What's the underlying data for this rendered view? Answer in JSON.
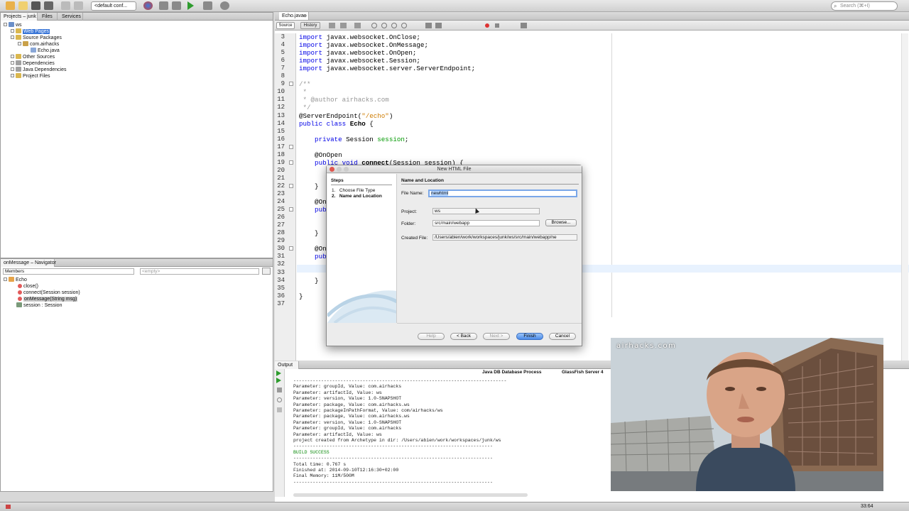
{
  "toolbar": {
    "config": "<default conf...",
    "search_placeholder": "Search (⌘+I)"
  },
  "projects_panel": {
    "tabs": [
      "Projects – junk",
      "Files",
      "Services"
    ],
    "tree": [
      {
        "label": "ws",
        "indent": 0
      },
      {
        "label": "Web Pages",
        "indent": 1,
        "selected": true
      },
      {
        "label": "Source Packages",
        "indent": 1
      },
      {
        "label": "com.airhacks",
        "indent": 2
      },
      {
        "label": "Echo.java",
        "indent": 3
      },
      {
        "label": "Other Sources",
        "indent": 1
      },
      {
        "label": "Dependencies",
        "indent": 1
      },
      {
        "label": "Java Dependencies",
        "indent": 1
      },
      {
        "label": "Project Files",
        "indent": 1
      }
    ]
  },
  "navigator": {
    "tab": "onMessage – Navigator",
    "filter": "Members",
    "empty": "<empty>",
    "root": "Echo",
    "members": [
      "close()",
      "connect(Session session)",
      "onMessage(String msg)",
      "session : Session"
    ]
  },
  "editor": {
    "tab": "Echo.java",
    "source_tab": "Source",
    "history_tab": "History",
    "line_numbers": [
      "3",
      "4",
      "5",
      "6",
      "7",
      "8",
      "9",
      "10",
      "11",
      "12",
      "13",
      "14",
      "15",
      "16",
      "17",
      "18",
      "19",
      "20",
      "21",
      "22",
      "23",
      "24",
      "25",
      "26",
      "27",
      "28",
      "29",
      "30",
      "31",
      "32",
      "33",
      "34",
      "35",
      "36",
      "37"
    ],
    "lines": {
      "l3": "javax.websocket.OnClose;",
      "l4": "javax.websocket.OnMessage;",
      "l5": "javax.websocket.OnOpen;",
      "l6": "javax.websocket.Session;",
      "l7": "javax.websocket.server.ServerEndpoint;",
      "import_kw": "import",
      "l9": "/**",
      "l10": " *",
      "l11_tag": " * @author ",
      "l11_val": "airhacks.com",
      "l12": " */",
      "l13a": "@ServerEndpoint(",
      "l13b": "\"/echo\"",
      "l13c": ")",
      "l14a": "public class ",
      "l14b": "Echo",
      "l14c": " {",
      "l16a": "    private ",
      "l16b": "Session ",
      "l16c": "session",
      "l16d": ";",
      "l18": "    @OnOpen",
      "l19a": "    public void ",
      "l19b": "connect",
      "l19c": "(Session session) {",
      "l22": "    }",
      "l24": "    @On",
      "l25": "    pub",
      "l28": "    }",
      "l30": "    @On",
      "l31": "    pub",
      "l34": "    }",
      "l36": "}"
    }
  },
  "dialog": {
    "title": "New HTML File",
    "steps_title": "Steps",
    "steps": [
      "1.   Choose File Type",
      "2.   Name and Location"
    ],
    "section_title": "Name and Location",
    "file_name_label": "File Name:",
    "file_name": "newhtml",
    "project_label": "Project:",
    "project": "ws",
    "folder_label": "Folder:",
    "folder": "src/main/webapp",
    "browse": "Browse...",
    "created_label": "Created File:",
    "created": "/Users/abien/work/workspaces/junk/ws/src/main/webapp/ne",
    "buttons": {
      "help": "Help",
      "back": "< Back",
      "next": "Next >",
      "finish": "Finish",
      "cancel": "Cancel"
    }
  },
  "output": {
    "tab": "Output",
    "subtabs": [
      "Java DB Database Process",
      "GlassFish Server 4"
    ],
    "lines": [
      "-----------------------------------------------------------------------------",
      "Parameter: groupId, Value: com.airhacks",
      "Parameter: artifactId, Value: ws",
      "Parameter: version, Value: 1.0-SNAPSHOT",
      "Parameter: package, Value: com.airhacks.ws",
      "Parameter: packageInPathFormat, Value: com/airhacks/ws",
      "Parameter: package, Value: com.airhacks.ws",
      "Parameter: version, Value: 1.0-SNAPSHOT",
      "Parameter: groupId, Value: com.airhacks",
      "Parameter: artifactId, Value: ws",
      "project created from Archetype in dir: /Users/abien/work/workspaces/junk/ws",
      "------------------------------------------------------------------------",
      "BUILD SUCCESS",
      "------------------------------------------------------------------------",
      "Total time: 0.767 s",
      "Finished at: 2014-09-10T12:16:30+02:00",
      "Final Memory: 11M/500M",
      "------------------------------------------------------------------------"
    ]
  },
  "webcam": {
    "watermark": "airhacks.com"
  },
  "status": {
    "position": "33:64"
  }
}
